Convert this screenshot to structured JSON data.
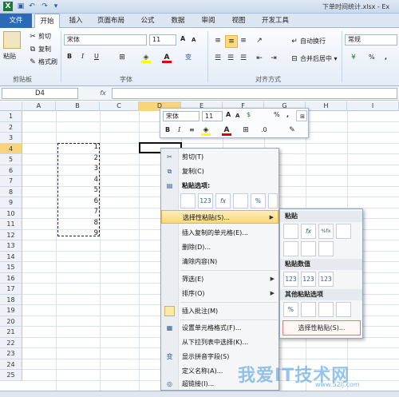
{
  "window": {
    "title": "下单时间统计.xlsx - Ex"
  },
  "quick_access": {
    "icons": [
      "excel-logo-icon",
      "save-icon",
      "undo-icon",
      "redo-icon",
      "customize-icon"
    ]
  },
  "tabs": [
    "文件",
    "开始",
    "插入",
    "页面布局",
    "公式",
    "数据",
    "审阅",
    "视图",
    "开发工具"
  ],
  "ribbon": {
    "clipboard": {
      "paste": "粘贴",
      "cut": "剪切",
      "copy": "复制",
      "format_painter": "格式刷",
      "label": "剪贴板"
    },
    "font": {
      "name": "宋体",
      "size": "11",
      "grow": "A",
      "shrink": "A",
      "bold": "B",
      "italic": "I",
      "underline": "U",
      "color_letter": "A",
      "phonetic": "变",
      "label": "字体"
    },
    "alignment": {
      "wrap": "自动换行",
      "merge": "合并后居中",
      "label": "对齐方式"
    },
    "number": {
      "format": "常规",
      "percent": "%",
      "comma": ","
    }
  },
  "formula_bar": {
    "name_box": "D4",
    "fx": "fx",
    "value": ""
  },
  "columns": [
    "A",
    "B",
    "C",
    "D",
    "E",
    "F",
    "G",
    "H",
    "I"
  ],
  "rows": [
    "1",
    "2",
    "3",
    "4",
    "5",
    "6",
    "7",
    "8",
    "9",
    "10",
    "11",
    "12",
    "13",
    "14",
    "15",
    "16",
    "17",
    "18",
    "19",
    "20",
    "21",
    "22",
    "23",
    "24",
    "25"
  ],
  "cells_b": [
    "1",
    "2",
    "3",
    "4",
    "5",
    "6",
    "7",
    "8",
    "9"
  ],
  "mini_toolbar": {
    "font": "宋体",
    "size": "11",
    "grow": "A",
    "shrink": "A",
    "currency": "$",
    "percent": "%",
    "comma": ",",
    "bold": "B",
    "italic": "I",
    "align": "≡",
    "color_letter": "A",
    "decimals": ".0"
  },
  "context_menu": {
    "cut": "剪切(T)",
    "copy": "复制(C)",
    "paste_options": "粘贴选项:",
    "paste_icons": [
      "",
      "123",
      "fx",
      "",
      "%",
      ""
    ],
    "paste_special": "选择性粘贴(S)...",
    "insert_copied": "插入复制的单元格(E)...",
    "delete": "删除(D)...",
    "clear": "清除内容(N)",
    "filter": "筛选(E)",
    "sort": "排序(O)",
    "insert_comment": "插入批注(M)",
    "format_cells": "设置单元格格式(F)...",
    "pick_list": "从下拉列表中选择(K)...",
    "phonetic": "显示拼音字段(S)",
    "define_name": "定义名称(A)...",
    "hyperlink": "超链接(I)..."
  },
  "submenu": {
    "paste": "粘贴",
    "paste_icons": [
      "",
      "fx",
      "%fx",
      "",
      "",
      "",
      ""
    ],
    "paste_values": "粘贴数值",
    "value_icons": [
      "123",
      "123",
      "123"
    ],
    "other_paste": "其他粘贴选项",
    "other_icons": [
      "%",
      "",
      "",
      ""
    ],
    "special": "选择性粘贴(S)..."
  },
  "watermark": {
    "text": "我爱IT技术网",
    "url": "www.52ij.com"
  }
}
